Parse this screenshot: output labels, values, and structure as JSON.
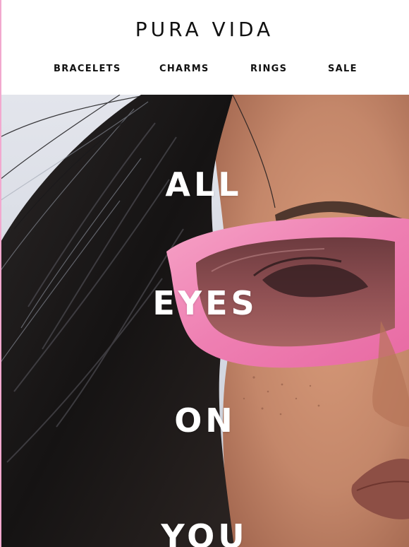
{
  "brand": {
    "logo_text": "PURA VIDA"
  },
  "nav": {
    "items": [
      {
        "label": "BRACELETS"
      },
      {
        "label": "CHARMS"
      },
      {
        "label": "RINGS"
      },
      {
        "label": "SALE"
      }
    ]
  },
  "hero": {
    "headline_lines": [
      "ALL",
      "EYES",
      "ON",
      "YOU"
    ],
    "image_description_icon": "hero-photo",
    "colors": {
      "sunglasses_frame": "#f07fb4",
      "lens": "#8a4a4f",
      "skin": "#c98b6b",
      "hair": "#1d1a1a",
      "sky": "#d9dde6",
      "accent_border": "#f2a9cf"
    }
  }
}
